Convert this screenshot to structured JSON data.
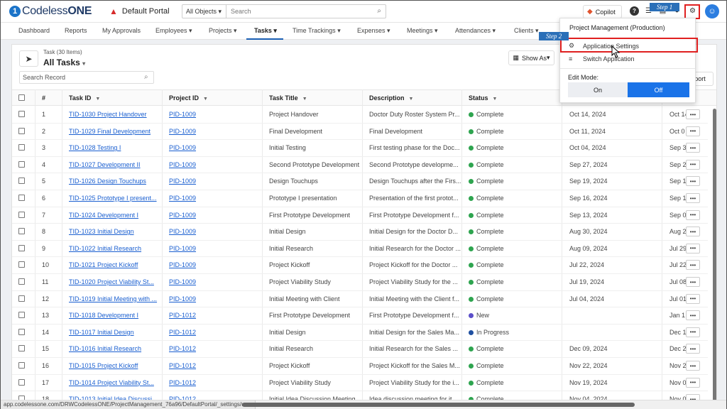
{
  "header": {
    "logo_mark": "1",
    "logo_word": "Codeless",
    "logo_bold": "ONE",
    "portal": "Default Portal",
    "search_scope": "All Objects",
    "search_placeholder": "Search",
    "copilot": "Copilot",
    "step1": "Step 1",
    "step2": "Step 2"
  },
  "nav": [
    "Dashboard",
    "Reports",
    "My Approvals",
    "Employees",
    "Projects",
    "Tasks",
    "Time Trackings",
    "Expenses",
    "Meetings",
    "Attendances",
    "Clients"
  ],
  "view": {
    "count": "Task (30 Items)",
    "title": "All Tasks",
    "record_search": "Search Record",
    "show_as": "Show As",
    "export": "port"
  },
  "columns": [
    "#",
    "Task ID",
    "Project ID",
    "Task Title",
    "Description",
    "Status"
  ],
  "rows": [
    {
      "n": "1",
      "task": "TID-1030 Project Handover",
      "pid": "PID-1009",
      "title": "Project Handover",
      "desc": "Doctor Duty Roster System Pr...",
      "status": "Complete",
      "d1": "Oct 14, 2024",
      "d2": "Oct 14"
    },
    {
      "n": "2",
      "task": "TID-1029 Final Development",
      "pid": "PID-1009",
      "title": "Final Development",
      "desc": "Final Development",
      "status": "Complete",
      "d1": "Oct 11, 2024",
      "d2": "Oct 0"
    },
    {
      "n": "3",
      "task": "TID-1028 Testing I",
      "pid": "PID-1009",
      "title": "Initial Testing",
      "desc": "First testing phase for the Doc...",
      "status": "Complete",
      "d1": "Oct 04, 2024",
      "d2": "Sep 3"
    },
    {
      "n": "4",
      "task": "TID-1027 Development II",
      "pid": "PID-1009",
      "title": "Second Prototype Development",
      "desc": "Second Prototype developme...",
      "status": "Complete",
      "d1": "Sep 27, 2024",
      "d2": "Sep 2"
    },
    {
      "n": "5",
      "task": "TID-1026 Design Touchups",
      "pid": "PID-1009",
      "title": "Design Touchups",
      "desc": "Design Touchups after the Firs...",
      "status": "Complete",
      "d1": "Sep 19, 2024",
      "d2": "Sep 1"
    },
    {
      "n": "6",
      "task": "TID-1025 Prototype I present...",
      "pid": "PID-1009",
      "title": "Prototype I presentation",
      "desc": "Presentation of the first protot...",
      "status": "Complete",
      "d1": "Sep 16, 2024",
      "d2": "Sep 1"
    },
    {
      "n": "7",
      "task": "TID-1024 Development I",
      "pid": "PID-1009",
      "title": "First Prototype Development",
      "desc": "First Prototype Development f...",
      "status": "Complete",
      "d1": "Sep 13, 2024",
      "d2": "Sep 0"
    },
    {
      "n": "8",
      "task": "TID-1023 Initial Design",
      "pid": "PID-1009",
      "title": "Initial Design",
      "desc": "Initial Design for the Doctor D...",
      "status": "Complete",
      "d1": "Aug 30, 2024",
      "d2": "Aug 2"
    },
    {
      "n": "9",
      "task": "TID-1022 Initial Research",
      "pid": "PID-1009",
      "title": "Initial Research",
      "desc": "Initial Research for the Doctor ...",
      "status": "Complete",
      "d1": "Aug 09, 2024",
      "d2": "Jul 29"
    },
    {
      "n": "10",
      "task": "TID-1021 Project Kickoff",
      "pid": "PID-1009",
      "title": "Project Kickoff",
      "desc": "Project Kickoff for the Doctor ...",
      "status": "Complete",
      "d1": "Jul 22, 2024",
      "d2": "Jul 22"
    },
    {
      "n": "11",
      "task": "TID-1020 Project Viability St...",
      "pid": "PID-1009",
      "title": "Project Viability Study",
      "desc": "Project Viability Study for the ...",
      "status": "Complete",
      "d1": "Jul 19, 2024",
      "d2": "Jul 08"
    },
    {
      "n": "12",
      "task": "TID-1019 Initial Meeting with ...",
      "pid": "PID-1009",
      "title": "Initial Meeting with Client",
      "desc": "Initial Meeting with the Client f...",
      "status": "Complete",
      "d1": "Jul 04, 2024",
      "d2": "Jul 01"
    },
    {
      "n": "13",
      "task": "TID-1018 Development I",
      "pid": "PID-1012",
      "title": "First Prototype Development",
      "desc": "First Prototype Development f...",
      "status": "New",
      "d1": "",
      "d2": "Jan 1"
    },
    {
      "n": "14",
      "task": "TID-1017 Initial Design",
      "pid": "PID-1012",
      "title": "Initial Design",
      "desc": "Initial Design for the Sales Ma...",
      "status": "In Progress",
      "d1": "",
      "d2": "Dec 1"
    },
    {
      "n": "15",
      "task": "TID-1016 Initial Research",
      "pid": "PID-1012",
      "title": "Initial Research",
      "desc": "Initial Research for the Sales ...",
      "status": "Complete",
      "d1": "Dec 09, 2024",
      "d2": "Dec 2"
    },
    {
      "n": "16",
      "task": "TID-1015 Project Kickoff",
      "pid": "PID-1012",
      "title": "Project Kickoff",
      "desc": "Project Kickoff for the Sales M...",
      "status": "Complete",
      "d1": "Nov 22, 2024",
      "d2": "Nov 2"
    },
    {
      "n": "17",
      "task": "TID-1014 Project Viability St...",
      "pid": "PID-1012",
      "title": "Project Viability Study",
      "desc": "Project Viability Study for the i...",
      "status": "Complete",
      "d1": "Nov 19, 2024",
      "d2": "Nov 0"
    },
    {
      "n": "18",
      "task": "TID-1013 Initial Idea Discussi...",
      "pid": "PID-1012",
      "title": "Initial Idea Discussion Meeting",
      "desc": "Idea discussion meeting for it...",
      "status": "Complete",
      "d1": "Nov 04, 2024",
      "d2": "Nov 0"
    }
  ],
  "status_colors": {
    "Complete": "#2ea44f",
    "New": "#5b4fc9",
    "In Progress": "#1f4fa0"
  },
  "dropdown": {
    "title": "Project Management (Production)",
    "app_settings": "Application Settings",
    "switch_app": "Switch Application",
    "edit_mode": "Edit Mode:",
    "on": "On",
    "off": "Off"
  },
  "statusbar": {
    "url": "app.codelessone.com/DRWCodelessONE/ProjectManagement_76a96/DefaultPortal/_settings/us..."
  }
}
